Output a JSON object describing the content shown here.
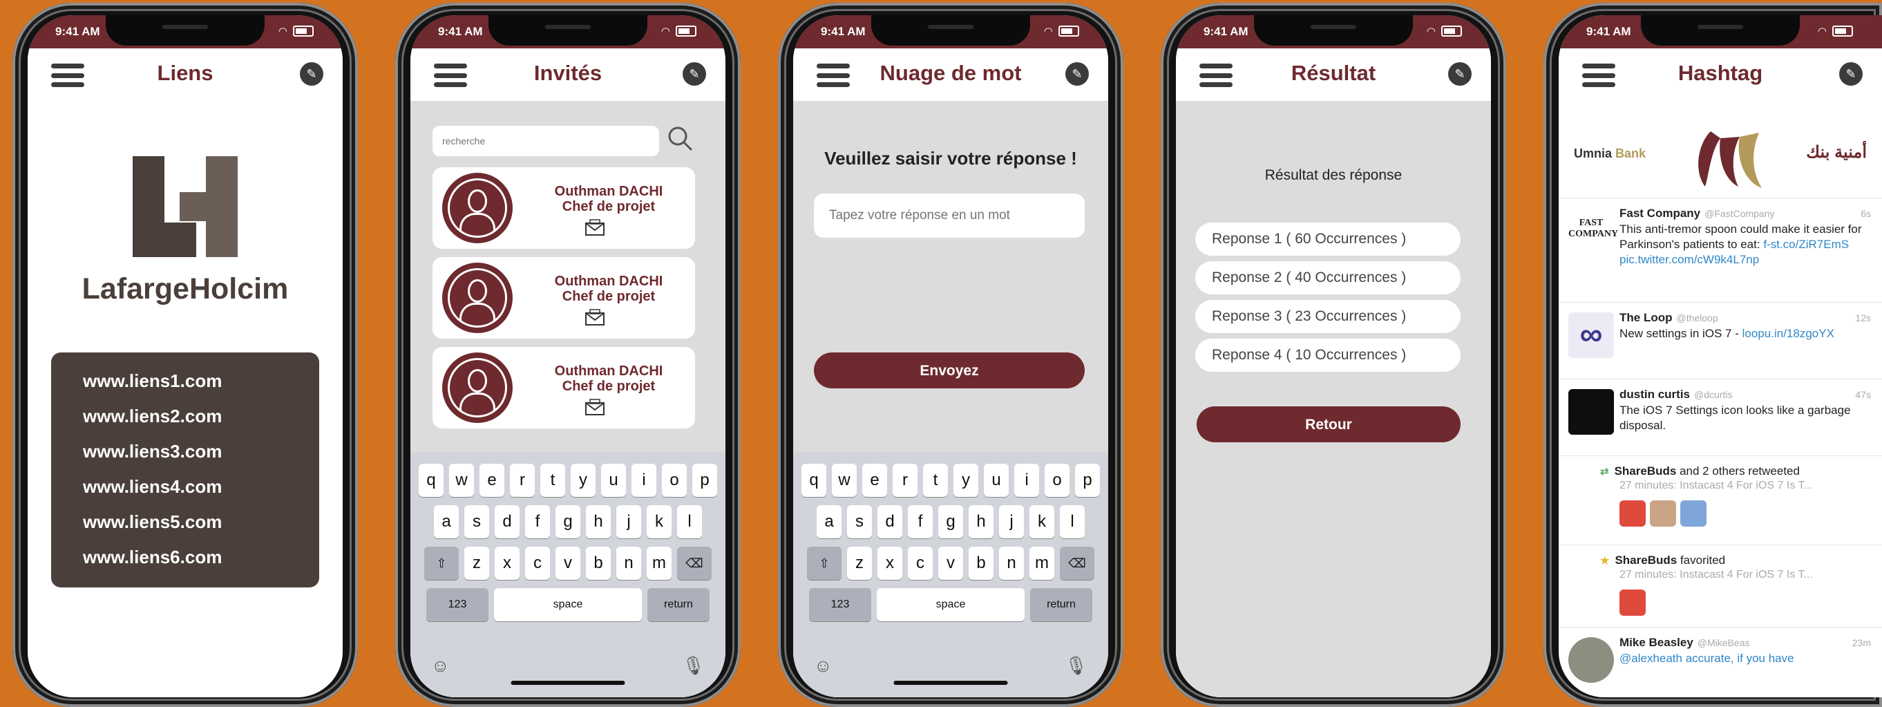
{
  "status": {
    "time": "9:41 AM"
  },
  "phone1": {
    "title": "Liens",
    "brand": "LafargeHolcim",
    "links": [
      "www.liens1.com",
      "www.liens2.com",
      "www.liens3.com",
      "www.liens4.com",
      "www.liens5.com",
      "www.liens6.com"
    ]
  },
  "phone2": {
    "title": "Invités",
    "search_placeholder": "recherche",
    "guests": [
      {
        "name": "Outhman DACHI",
        "role": "Chef de projet"
      },
      {
        "name": "Outhman DACHI",
        "role": "Chef de projet"
      },
      {
        "name": "Outhman DACHI",
        "role": "Chef de projet"
      }
    ]
  },
  "keyboard": {
    "row1": [
      "q",
      "w",
      "e",
      "r",
      "t",
      "y",
      "u",
      "i",
      "o",
      "p"
    ],
    "row2": [
      "a",
      "s",
      "d",
      "f",
      "g",
      "h",
      "j",
      "k",
      "l"
    ],
    "row3": [
      "z",
      "x",
      "c",
      "v",
      "b",
      "n",
      "m"
    ],
    "numbers": "123",
    "space": "space",
    "return": "return",
    "shift": "⇧",
    "delete": "⌫",
    "emoji": "☺",
    "mic": "🎙"
  },
  "phone3": {
    "title": "Nuage de mot",
    "prompt": "Veuillez saisir votre réponse !",
    "input_placeholder": "Tapez votre réponse en un mot",
    "submit": "Envoyez"
  },
  "phone4": {
    "title": "Résultat",
    "subtitle": "Résultat des réponse",
    "results": [
      "Reponse 1 ( 60 Occurrences )",
      "Reponse 2 ( 40 Occurrences )",
      "Reponse 3 ( 23 Occurrences )",
      "Reponse 4 ( 10 Occurrences )"
    ],
    "back": "Retour"
  },
  "phone5": {
    "title": "Hashtag",
    "bank_en_1": "Umnia",
    "bank_en_2": "Bank",
    "bank_ar": "أمنية بنك",
    "tweets": [
      {
        "name": "Fast Company",
        "handle": "@FastCompany",
        "time": "6s",
        "text": "This anti-tremor spoon could make it easier for Parkinson's patients to eat:",
        "link": "f-st.co/ZiR7EmS pic.twitter.com/cW9k4L7np",
        "avatar_text": "FAST COMPANY"
      },
      {
        "name": "The Loop",
        "handle": "@theloop",
        "time": "12s",
        "text": "New settings in iOS 7 -",
        "link": "loopu.in/18zgoYX",
        "avatar_text": "∞"
      },
      {
        "name": "dustin curtis",
        "handle": "@dcurtis",
        "time": "47s",
        "text": "The iOS 7 Settings icon looks like a garbage disposal.",
        "link": "",
        "avatar_text": ""
      },
      {
        "name": "ShareBuds",
        "suffix": "and 2 others retweeted",
        "sub": "27 minutes: Instacast 4 For iOS 7 Is T...",
        "marker": "⇄"
      },
      {
        "name": "ShareBuds",
        "suffix": "favorited",
        "sub": "27 minutes: Instacast 4 For iOS 7 Is T...",
        "marker": "★"
      },
      {
        "name": "Mike Beasley",
        "handle": "@MikeBeas",
        "time": "23m",
        "text": "@alexheath accurate, if you have"
      }
    ]
  }
}
